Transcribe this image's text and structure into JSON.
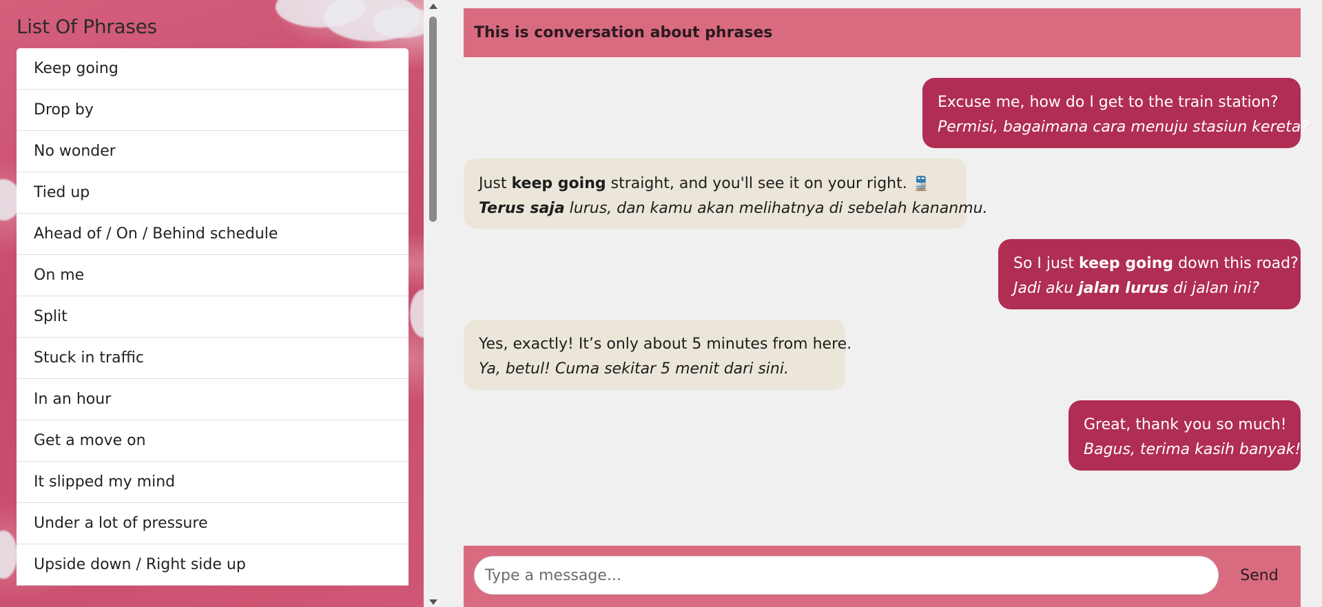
{
  "sidebar": {
    "title": "List Of Phrases",
    "phrases": [
      "Keep going",
      "Drop by",
      "No wonder",
      "Tied up",
      "Ahead of / On / Behind schedule",
      "On me",
      "Split",
      "Stuck in traffic",
      "In an hour",
      "Get a move on",
      "It slipped my mind",
      "Under a lot of pressure",
      "Upside down / Right side up"
    ]
  },
  "chat": {
    "header": "This is conversation about phrases",
    "messages": [
      {
        "side": "sent",
        "text": "Excuse me, how do I get to the train station?",
        "translation": "Permisi, bagaimana cara menuju stasiun kereta?"
      },
      {
        "side": "received",
        "text_parts": [
          "Just ",
          "keep going",
          " straight, and you'll see it on your right."
        ],
        "icon": "train-icon",
        "translation_parts": [
          "Terus saja",
          " lurus, dan kamu akan melihatnya di sebelah kananmu."
        ]
      },
      {
        "side": "sent",
        "text_parts": [
          "So I just ",
          "keep going",
          " down this road?"
        ],
        "translation_parts": [
          "Jadi aku ",
          "jalan lurus",
          " di jalan ini?"
        ]
      },
      {
        "side": "received",
        "text": "Yes, exactly! It’s only about 5 minutes from here.",
        "translation": "Ya, betul! Cuma sekitar 5 menit dari sini."
      },
      {
        "side": "sent",
        "text": "Great, thank you so much!",
        "translation": "Bagus, terima kasih banyak!"
      }
    ],
    "composer": {
      "placeholder": "Type a message...",
      "send_label": "Send"
    }
  },
  "colors": {
    "accent": "#d96b81",
    "sent_bubble": "#b02d53",
    "received_bubble": "#ebe6d9",
    "background": "#f0f0f0"
  }
}
